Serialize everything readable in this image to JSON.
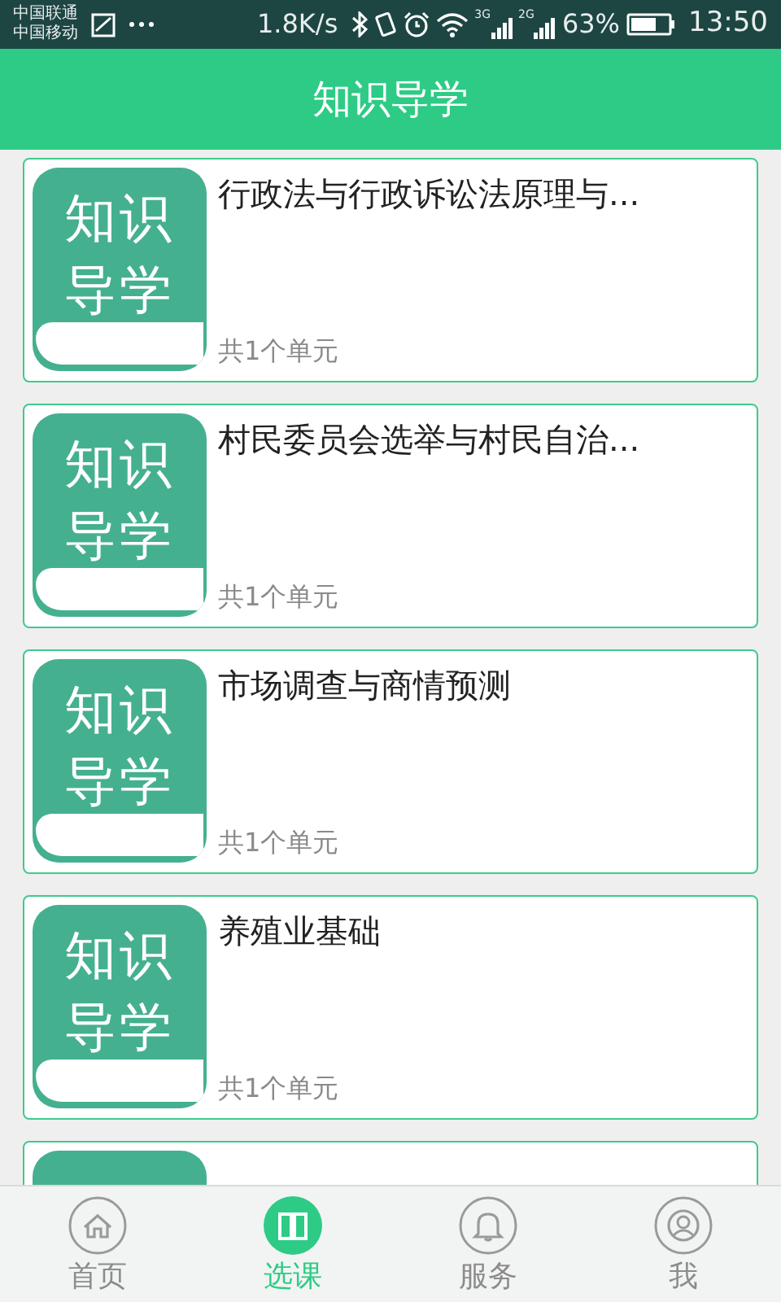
{
  "status_bar": {
    "carriers": [
      "中国联通",
      "中国移动"
    ],
    "speed": "1.8K/s",
    "network_1": "3G",
    "network_2": "2G",
    "battery": "63%",
    "time": "13:50"
  },
  "header": {
    "title": "知识导学"
  },
  "courses": [
    {
      "title": "行政法与行政诉讼法原理与...",
      "units": "共1个单元",
      "cover_lines": [
        "知识",
        "导学"
      ]
    },
    {
      "title": "村民委员会选举与村民自治...",
      "units": "共1个单元",
      "cover_lines": [
        "知识",
        "导学"
      ]
    },
    {
      "title": "市场调查与商情预测",
      "units": "共1个单元",
      "cover_lines": [
        "知识",
        "导学"
      ]
    },
    {
      "title": "养殖业基础",
      "units": "共1个单元",
      "cover_lines": [
        "知识",
        "导学"
      ]
    }
  ],
  "more_below": true,
  "tabs": [
    {
      "label": "首页",
      "kind": "home",
      "selected": false
    },
    {
      "label": "选课",
      "kind": "book",
      "selected": true
    },
    {
      "label": "服务",
      "kind": "bell",
      "selected": false
    },
    {
      "label": "我",
      "kind": "user",
      "selected": false
    }
  ]
}
